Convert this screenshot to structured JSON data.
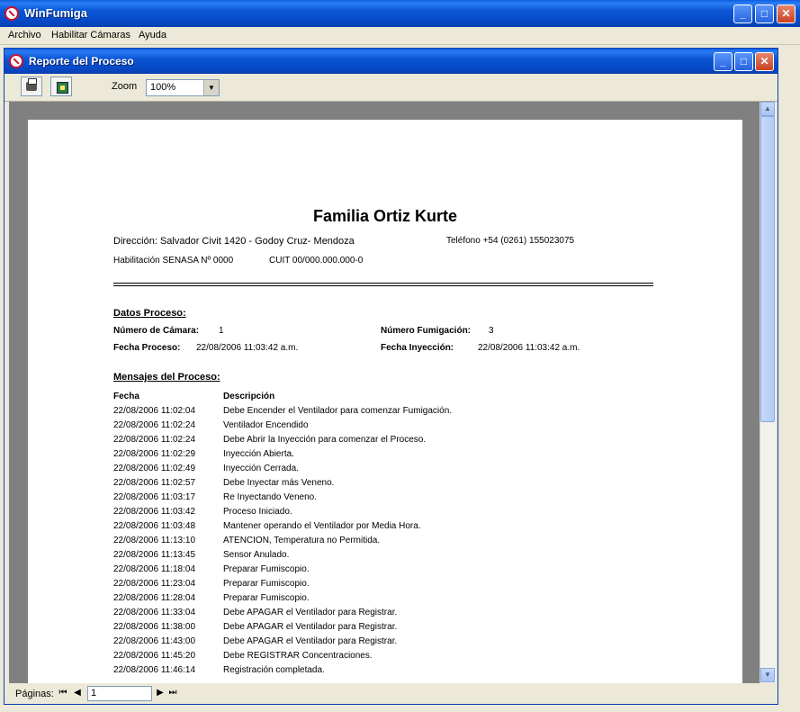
{
  "window": {
    "title": "WinFumiga"
  },
  "menu": [
    "Archivo",
    "Habilitar Cámaras",
    "Ayuda"
  ],
  "child": {
    "title": "Reporte del Proceso"
  },
  "toolbar": {
    "zoom_label": "Zoom",
    "zoom_value": "100%"
  },
  "status": {
    "pages_label": "Páginas:",
    "page_value": "1"
  },
  "report": {
    "title": "Familia Ortiz Kurte",
    "address": "Dirección: Salvador Civit 1420 - Godoy Cruz- Mendoza",
    "phone": "Teléfono +54 (0261) 155023075",
    "senasa": "Habilitación SENASA Nº 0000",
    "cuit": "CUIT 00/000.000.000-0",
    "datos_heading": "Datos Proceso:",
    "camara_label": "Número de Cámara:",
    "camara_value": "1",
    "fumigacion_label": "Número Fumigación:",
    "fumigacion_value": "3",
    "fecha_proceso_label": "Fecha Proceso:",
    "fecha_proceso_value": "22/08/2006 11:03:42 a.m.",
    "fecha_inyeccion_label": "Fecha Inyección:",
    "fecha_inyeccion_value": "22/08/2006 11:03:42 a.m.",
    "mensajes_heading": "Mensajes del Proceso:",
    "col_fecha": "Fecha",
    "col_descripcion": "Descripción",
    "messages": [
      {
        "fecha": "22/08/2006 11:02:04",
        "desc": "Debe Encender el Ventilador para comenzar Fumigación."
      },
      {
        "fecha": "22/08/2006 11:02:24",
        "desc": "Ventilador Encendido"
      },
      {
        "fecha": "22/08/2006 11:02:24",
        "desc": "Debe Abrir la Inyección para comenzar el Proceso."
      },
      {
        "fecha": "22/08/2006 11:02:29",
        "desc": "Inyección Abierta."
      },
      {
        "fecha": "22/08/2006 11:02:49",
        "desc": "Inyección Cerrada."
      },
      {
        "fecha": "22/08/2006 11:02:57",
        "desc": "Debe Inyectar más Veneno."
      },
      {
        "fecha": "22/08/2006 11:03:17",
        "desc": "Re Inyectando Veneno."
      },
      {
        "fecha": "22/08/2006 11:03:42",
        "desc": "Proceso Iniciado."
      },
      {
        "fecha": "22/08/2006 11:03:48",
        "desc": "Mantener operando el Ventilador por Media Hora."
      },
      {
        "fecha": "22/08/2006 11:13:10",
        "desc": "ATENCION, Temperatura no Permitida."
      },
      {
        "fecha": "22/08/2006 11:13:45",
        "desc": "Sensor Anulado."
      },
      {
        "fecha": "22/08/2006 11:18:04",
        "desc": "Preparar Fumiscopio."
      },
      {
        "fecha": "22/08/2006 11:23:04",
        "desc": "Preparar Fumiscopio."
      },
      {
        "fecha": "22/08/2006 11:28:04",
        "desc": "Preparar Fumiscopio."
      },
      {
        "fecha": "22/08/2006 11:33:04",
        "desc": "Debe APAGAR el Ventilador para Registrar."
      },
      {
        "fecha": "22/08/2006 11:38:00",
        "desc": "Debe APAGAR el Ventilador para Registrar."
      },
      {
        "fecha": "22/08/2006 11:43:00",
        "desc": "Debe APAGAR el Ventilador para Registrar."
      },
      {
        "fecha": "22/08/2006 11:45:20",
        "desc": "Debe REGISTRAR Concentraciones."
      },
      {
        "fecha": "22/08/2006 11:46:14",
        "desc": "Registración completada."
      }
    ]
  }
}
